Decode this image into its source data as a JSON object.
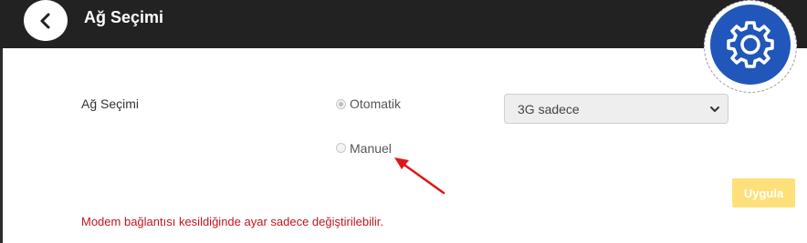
{
  "header": {
    "title": "Ağ Seçimi"
  },
  "form": {
    "label": "Ağ Seçimi",
    "options": [
      {
        "label": "Otomatik",
        "checked": true
      },
      {
        "label": "Manuel",
        "checked": false
      }
    ],
    "select_value": "3G sadece",
    "apply_label": "Uygula"
  },
  "warning": "Modem bağlantısı kesildiğinde ayar sadece değiştirilebilir.",
  "colors": {
    "header_bg": "#222222",
    "gear_bg": "#2156ba",
    "apply_bg": "#fde07a",
    "warning": "#c0161c",
    "arrow": "#e0141a"
  },
  "icons": {
    "back": "chevron-left-icon",
    "settings": "gear-icon",
    "select": "chevron-down-icon"
  }
}
